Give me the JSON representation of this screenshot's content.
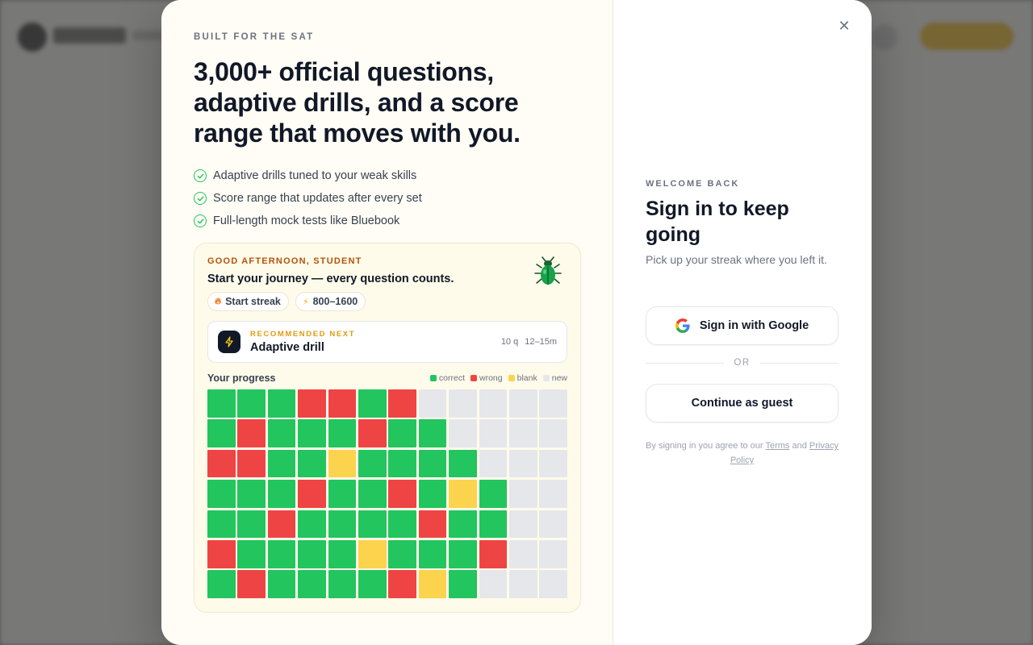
{
  "modal": {
    "left": {
      "eyebrow": "BUILT FOR THE SAT",
      "headline": "3,000+ official questions, adaptive drills, and a score range that moves with you.",
      "features": [
        "Adaptive drills tuned to your weak skills",
        "Score range that updates after every set",
        "Full-length mock tests like Bluebook"
      ],
      "card": {
        "greeting": "GOOD AFTERNOON, STUDENT",
        "journey": "Start your journey — every question counts.",
        "streak_pill": "Start streak",
        "score_pill": "800–1600",
        "recommended": {
          "eyebrow": "RECOMMENDED NEXT",
          "title": "Adaptive drill",
          "questions": "10 q",
          "duration": "12–15m"
        },
        "progress": {
          "title": "Your progress",
          "legend": {
            "correct": "correct",
            "wrong": "wrong",
            "blank": "blank",
            "new": "new"
          },
          "colors": {
            "c": "#22c55e",
            "w": "#ef4444",
            "b": "#fcd34d",
            "n": "#e5e7eb"
          },
          "rows": [
            [
              "c",
              "c",
              "c",
              "w",
              "w",
              "c",
              "w",
              "n",
              "n",
              "n",
              "n",
              "n"
            ],
            [
              "c",
              "w",
              "c",
              "c",
              "c",
              "w",
              "c",
              "c",
              "n",
              "n",
              "n",
              "n"
            ],
            [
              "w",
              "w",
              "c",
              "c",
              "b",
              "c",
              "c",
              "c",
              "c",
              "n",
              "n",
              "n"
            ],
            [
              "c",
              "c",
              "c",
              "w",
              "c",
              "c",
              "w",
              "c",
              "b",
              "c",
              "n",
              "n"
            ],
            [
              "c",
              "c",
              "w",
              "c",
              "c",
              "c",
              "c",
              "w",
              "c",
              "c",
              "n",
              "n"
            ],
            [
              "w",
              "c",
              "c",
              "c",
              "c",
              "b",
              "c",
              "c",
              "c",
              "w",
              "n",
              "n"
            ],
            [
              "c",
              "w",
              "c",
              "c",
              "c",
              "c",
              "w",
              "b",
              "c",
              "n",
              "n",
              "n"
            ]
          ]
        }
      }
    },
    "right": {
      "eyebrow": "WELCOME BACK",
      "title": "Sign in to keep going",
      "subtitle": "Pick up your streak where you left it.",
      "google_button": "Sign in with Google",
      "divider": "OR",
      "guest_button": "Continue as guest",
      "legal_prefix": "By signing in you agree to our",
      "terms": "Terms",
      "legal_and": "and",
      "privacy": "Privacy Policy"
    }
  }
}
